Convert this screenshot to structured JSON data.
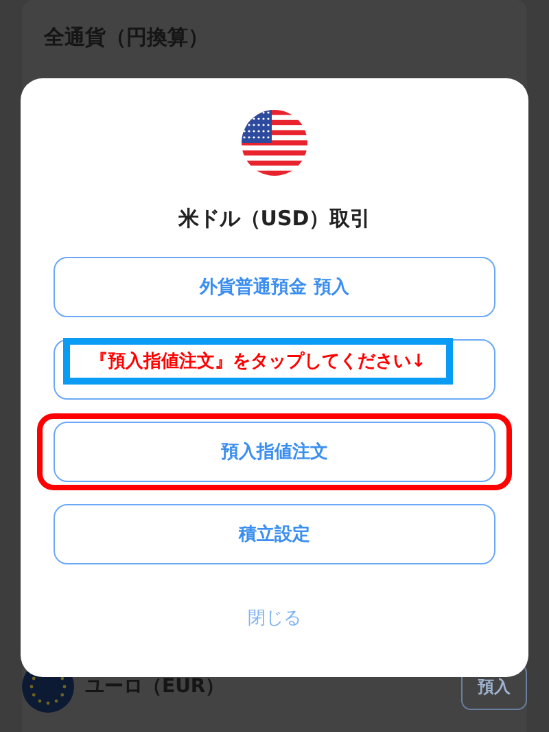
{
  "background": {
    "section_title": "全通貨（円換算）",
    "currency_row": {
      "name": "ユーロ（EUR）",
      "button": "預入"
    }
  },
  "modal": {
    "title": "米ドル（USD）取引",
    "actions": [
      {
        "label": "外貨普通預金 預入",
        "highlighted": false
      },
      {
        "highlighted": false,
        "annotation": "『預入指値注文』をタップしてください↓"
      },
      {
        "label": "預入指値注文",
        "highlighted": true
      },
      {
        "label": "積立設定",
        "highlighted": false
      }
    ],
    "close": "閉じる"
  }
}
